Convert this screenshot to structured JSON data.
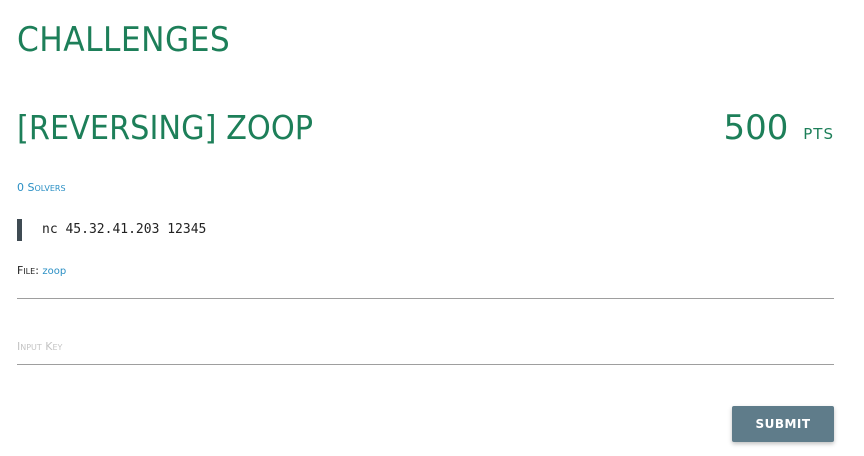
{
  "header": {
    "title": "CHALLENGES"
  },
  "challenge": {
    "title": "[REVERSING] ZOOP",
    "points_value": "500",
    "points_unit": "pts",
    "solvers": "0 Solvers",
    "connection": "nc 45.32.41.203 12345",
    "file_label": "File:",
    "file_name": "zoop"
  },
  "form": {
    "key_placeholder": "Input Key",
    "key_value": "",
    "submit_label": "SUBMIT"
  },
  "colors": {
    "accent": "#1d7f59",
    "link": "#2a8fc4",
    "button": "#5f7c8a",
    "quote_bar": "#3f4b53"
  }
}
